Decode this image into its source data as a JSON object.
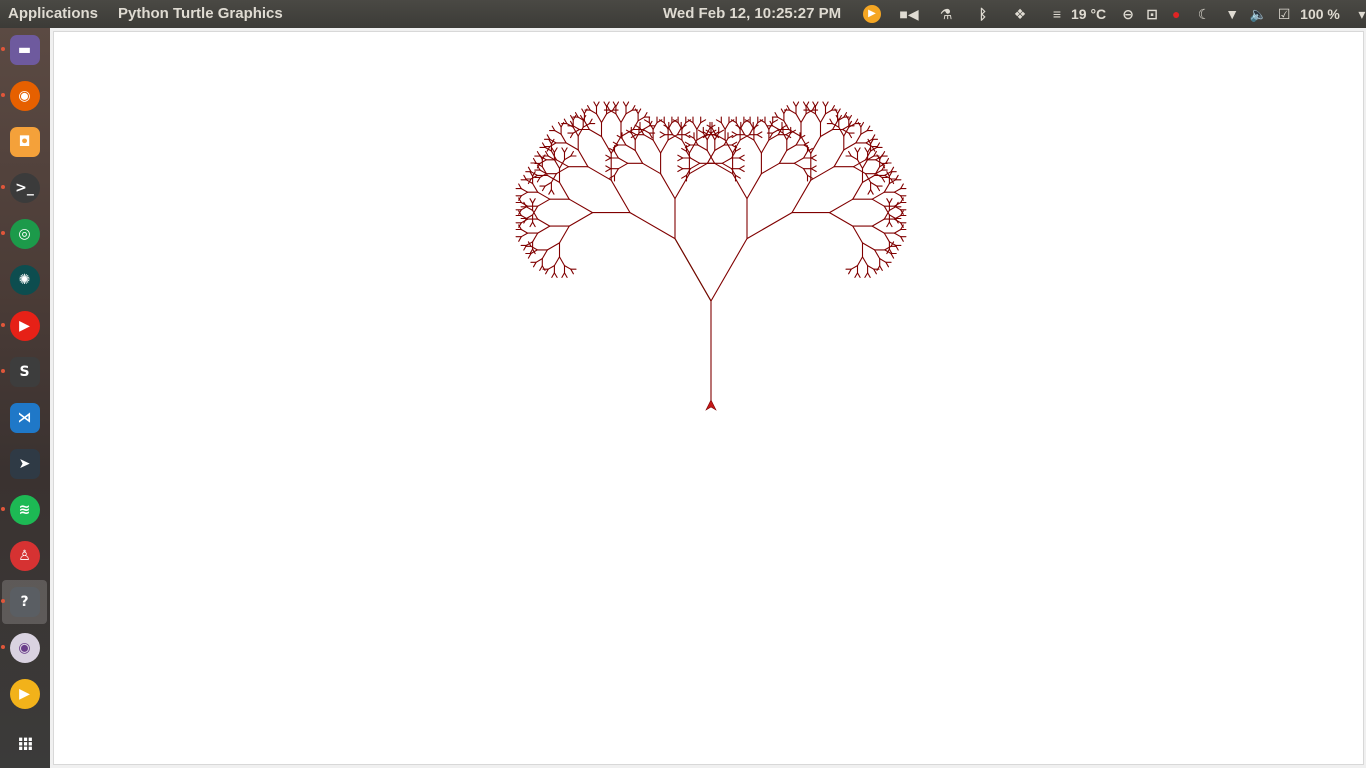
{
  "panel": {
    "applications_label": "Applications",
    "active_app_title": "Python Turtle Graphics",
    "clock": "Wed Feb 12, 10:25:27 PM",
    "weather": "19 °C",
    "battery": "100 %"
  },
  "tray_icons": [
    "media-player-icon",
    "video-camera-icon",
    "flask-icon",
    "bluetooth-icon",
    "dropbox-icon",
    "weather-icon",
    "minus-circle-icon",
    "screen-record-icon",
    "stop-record-icon",
    "night-mode-icon",
    "wifi-icon",
    "volume-icon",
    "clipboard-icon",
    "battery-icon",
    "chevron-down-icon"
  ],
  "launcher": [
    {
      "name": "files",
      "icon": "folder-icon",
      "color": "#6e5a9e",
      "glyph": "▬",
      "running": true
    },
    {
      "name": "firefox",
      "icon": "firefox-icon",
      "color": "#e66000",
      "glyph": "◉",
      "running": true
    },
    {
      "name": "software-center",
      "icon": "software-center-icon",
      "color": "#f4a13a",
      "glyph": "◘",
      "running": false
    },
    {
      "name": "terminal",
      "icon": "terminal-icon",
      "color": "#3b3b3b",
      "glyph": ">_",
      "running": true
    },
    {
      "name": "chrome",
      "icon": "chrome-icon",
      "color": "#1c9a4a",
      "glyph": "◎",
      "running": true
    },
    {
      "name": "gitkraken",
      "icon": "gitkraken-icon",
      "color": "#0d4d4f",
      "glyph": "✺",
      "running": false
    },
    {
      "name": "youtube-music",
      "icon": "youtube-music-icon",
      "color": "#e62117",
      "glyph": "▶",
      "running": true
    },
    {
      "name": "sublime",
      "icon": "sublime-text-icon",
      "color": "#3d3d3d",
      "glyph": "S",
      "running": true
    },
    {
      "name": "vscode",
      "icon": "vscode-icon",
      "color": "#1f78c8",
      "glyph": "⋊",
      "running": false
    },
    {
      "name": "postman-like",
      "icon": "arrow-app-icon",
      "color": "#2f3a45",
      "glyph": "➤",
      "running": false
    },
    {
      "name": "spotify",
      "icon": "spotify-icon",
      "color": "#1db954",
      "glyph": "≋",
      "running": true
    },
    {
      "name": "lab",
      "icon": "flask-app-icon",
      "color": "#d63232",
      "glyph": "♙",
      "running": false
    },
    {
      "name": "python-turtle",
      "icon": "unknown-app-icon",
      "color": "#5a5e63",
      "glyph": "?",
      "running": true,
      "active": true
    },
    {
      "name": "webcam",
      "icon": "webcam-icon",
      "color": "#d9d2e0",
      "glyph": "◉",
      "running": true
    },
    {
      "name": "media-player",
      "icon": "play-app-icon",
      "color": "#f2b21a",
      "glyph": "▶",
      "running": false
    },
    {
      "name": "show-apps",
      "icon": "app-grid-icon",
      "color": "transparent",
      "glyph": "⁝⁝⁝",
      "running": false
    }
  ],
  "colors": {
    "tree": "#800000",
    "tree_accent": "#0b5e0b",
    "turtle": "#c41818"
  }
}
